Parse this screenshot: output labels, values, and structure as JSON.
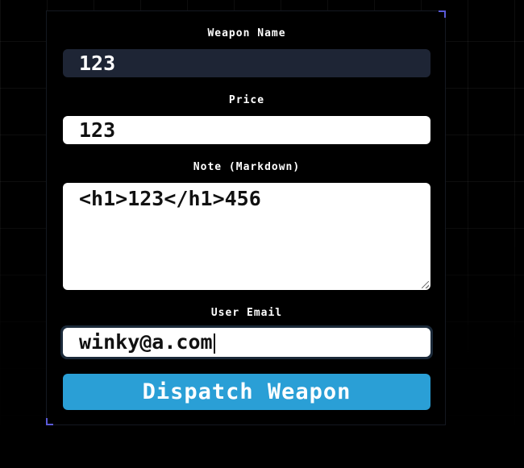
{
  "form": {
    "weapon_name": {
      "label": "Weapon Name",
      "value": "123"
    },
    "price": {
      "label": "Price",
      "value": "123"
    },
    "note": {
      "label": "Note (Markdown)",
      "value": "<h1>123</h1>456"
    },
    "email": {
      "label": "User Email",
      "value": "winky@a.com"
    },
    "submit_label": "Dispatch Weapon"
  },
  "colors": {
    "background": "#000000",
    "input_dark": "#1e2535",
    "input_light": "#ffffff",
    "button": "#2a9fd6",
    "corner_accent": "#5a5ad8"
  }
}
